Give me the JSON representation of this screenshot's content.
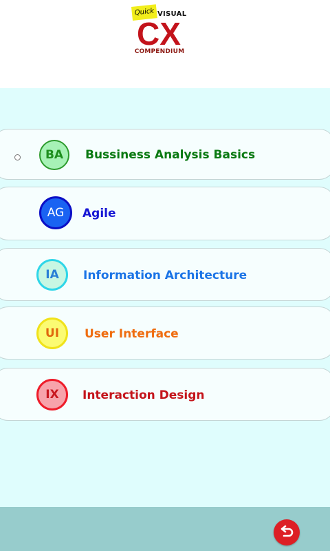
{
  "logo": {
    "quick": "Quick",
    "visual": "VISUAL",
    "title": "CX",
    "subtitle": "COMPENDIUM"
  },
  "menu": {
    "items": [
      {
        "badge": "BA",
        "label": "Bussiness Analysis Basics",
        "badge_fill": "#a7f2b6",
        "badge_border": "#2d9b2d",
        "badge_text": "#1f8f1f",
        "label_color": "#0b7a13"
      },
      {
        "badge": "AG",
        "label": "Agile",
        "badge_fill": "#1a63f2",
        "badge_border": "#0b0fc6",
        "badge_text": "#ffffff",
        "label_color": "#1616d4"
      },
      {
        "badge": "IA",
        "label": "Information Architecture",
        "badge_fill": "#c8f7e3",
        "badge_border": "#2fd6e8",
        "badge_text": "#2a7fd6",
        "label_color": "#1c74e6"
      },
      {
        "badge": "UI",
        "label": "User Interface",
        "badge_fill": "#fbfb73",
        "badge_border": "#f0e21a",
        "badge_text": "#e0670e",
        "label_color": "#ef6d10"
      },
      {
        "badge": "IX",
        "label": "Interaction Design",
        "badge_fill": "#f7a3ab",
        "badge_border": "#ee1c2a",
        "badge_text": "#c8171f",
        "label_color": "#c4141b"
      }
    ]
  },
  "footer": {
    "back_icon": "undo-arrow-icon",
    "back_color": "#dd1f25"
  }
}
